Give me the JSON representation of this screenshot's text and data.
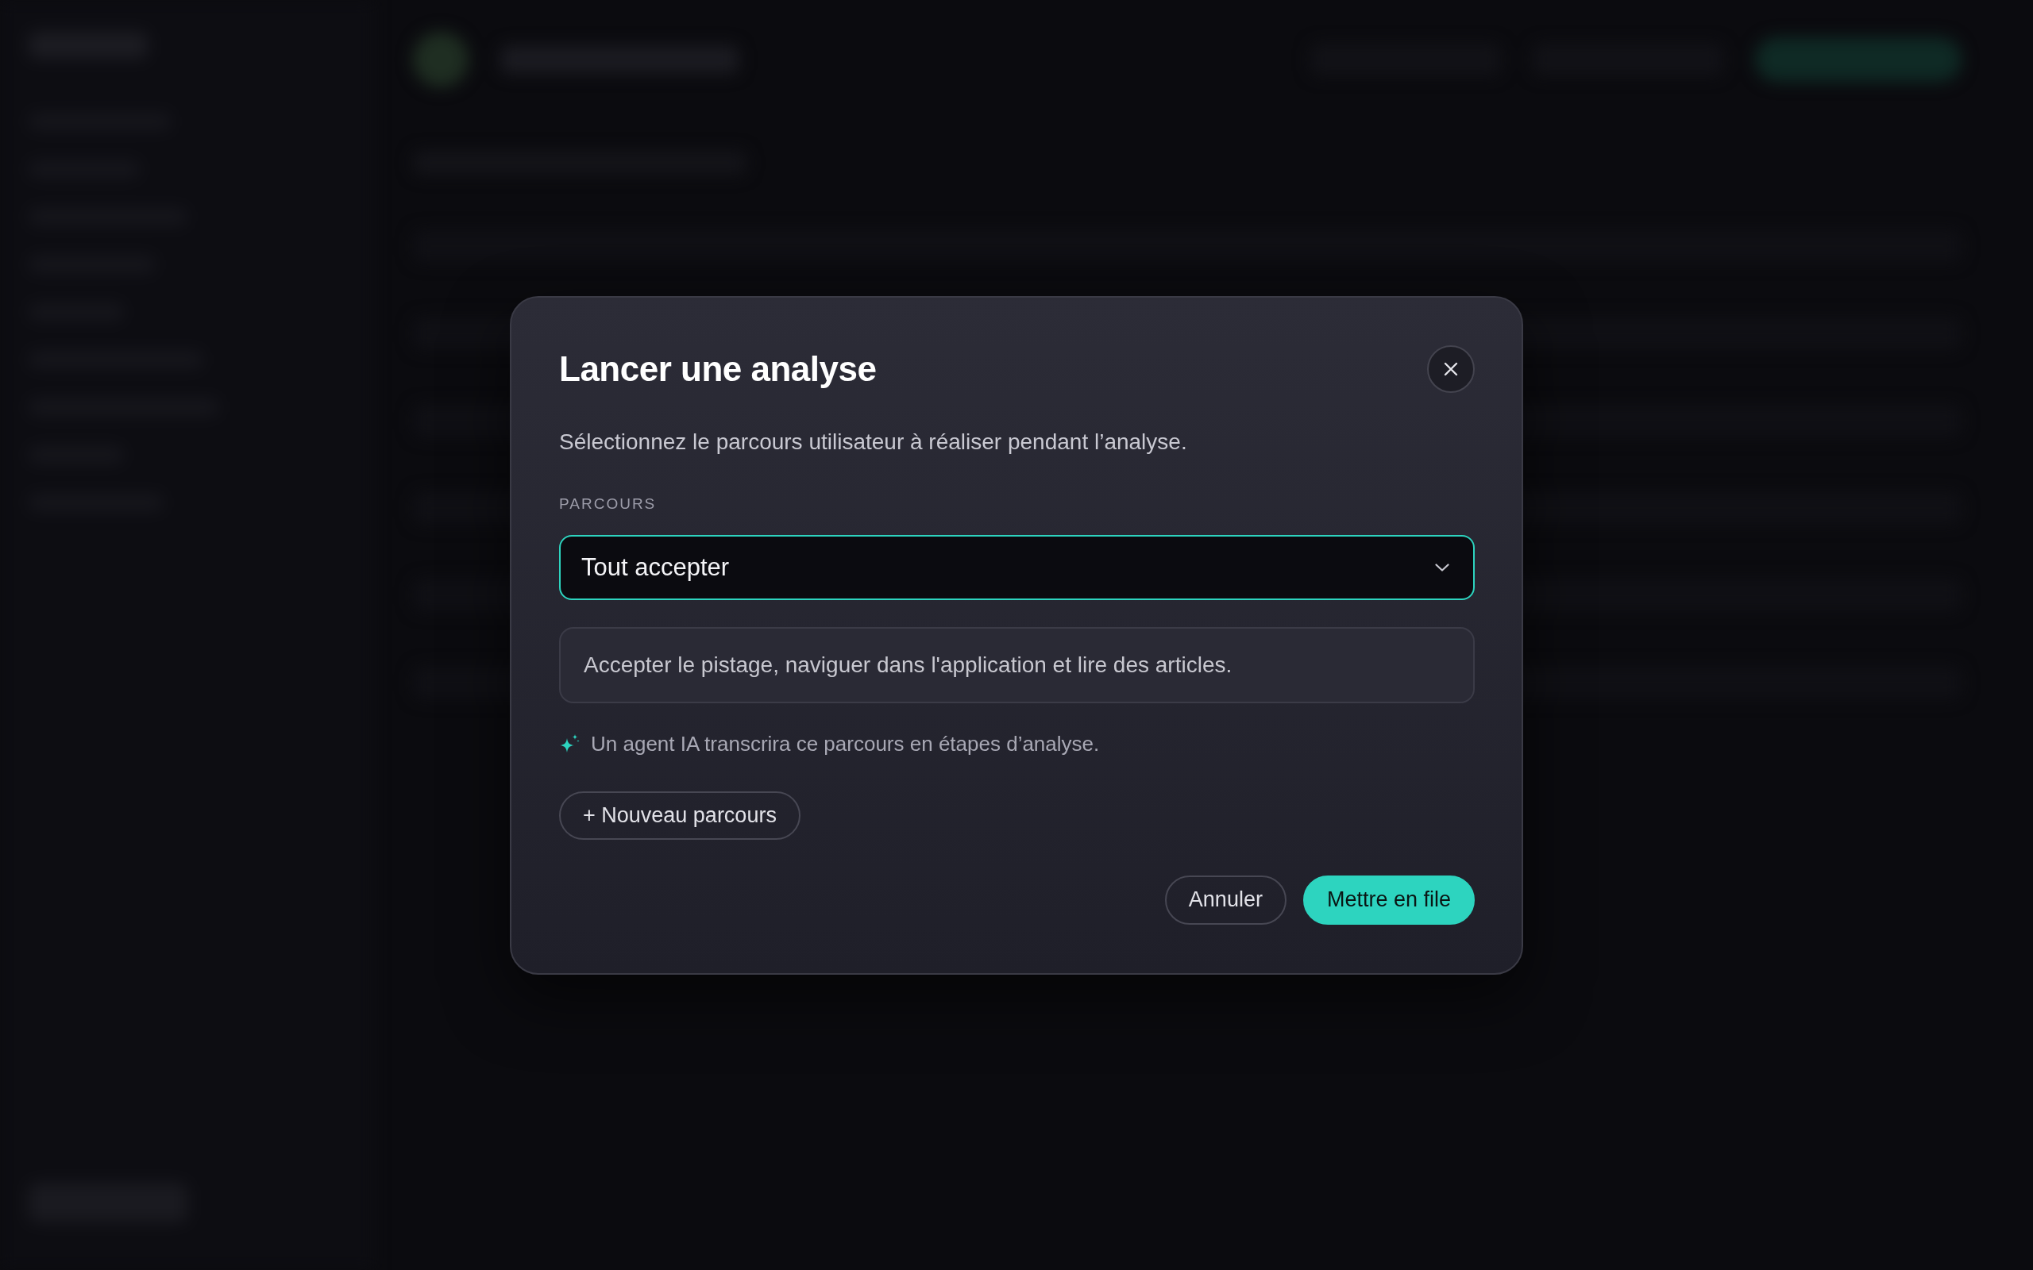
{
  "dialog": {
    "title": "Lancer une analyse",
    "description": "Sélectionnez le parcours utilisateur à réaliser pendant l’analyse.",
    "field": {
      "label": "PARCOURS",
      "value": "Tout accepter",
      "focused": true
    },
    "journey_description": "Accepter le pistage, naviguer dans l'application et lire des articles.",
    "ai_hint": "Un agent IA transcrira ce parcours en étapes d’analyse.",
    "new_button": "+ Nouveau parcours",
    "buttons": [
      {
        "label": "Annuler",
        "kind": "secondary"
      },
      {
        "label": "Mettre en file",
        "kind": "primary"
      }
    ]
  }
}
